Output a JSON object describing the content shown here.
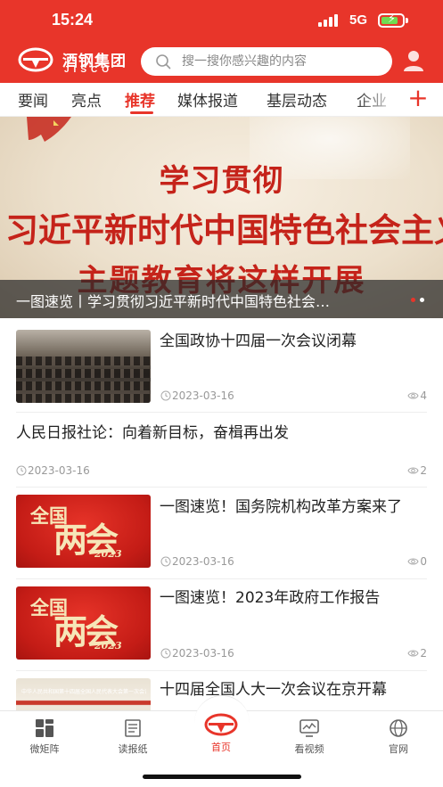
{
  "status_bar": {
    "time": "15:24",
    "network": "5G"
  },
  "header": {
    "logo_name": "酒钢集团",
    "logo_en": "JISCO",
    "search_placeholder": "搜一搜你感兴趣的内容",
    "brand_color": "#e8352a"
  },
  "tabs": [
    {
      "label": "要闻",
      "active": false
    },
    {
      "label": "亮点",
      "active": false
    },
    {
      "label": "推荐",
      "active": true
    },
    {
      "label": "媒体报道",
      "active": false
    },
    {
      "label": "基层动态",
      "active": false
    },
    {
      "label": "企业",
      "active": false
    }
  ],
  "add_tab_label": "+",
  "banner": {
    "line1": "学习贯彻",
    "line2": "习近平新时代中国特色社会主义思想",
    "line3": "主题教育将这样开展",
    "caption": "一图速览丨学习贯彻习近平新时代中国特色社会…",
    "page_count": 2,
    "active_page": 1
  },
  "news": [
    {
      "title": "全国政协十四届一次会议闭幕",
      "date": "2023-03-16",
      "views": "4",
      "thumb": "photo"
    },
    {
      "title": "人民日报社论：向着新目标，奋楫再出发",
      "date": "2023-03-16",
      "views": "2",
      "thumb": "none"
    },
    {
      "title": "一图速览！国务院机构改革方案来了",
      "date": "2023-03-16",
      "views": "0",
      "thumb": "lianghui"
    },
    {
      "title": "一图速览！2023年政府工作报告",
      "date": "2023-03-16",
      "views": "2",
      "thumb": "lianghui"
    },
    {
      "title": "十四届全国人大一次会议在京开幕",
      "thumb": "stage"
    }
  ],
  "thumb_text": {
    "quanguo": "全国",
    "lianghui": "两会",
    "year": "2023",
    "stage_banner": "中华人民共和国第十四届全国人民代表大会第一次会议"
  },
  "bottom_nav": [
    {
      "label": "微矩阵",
      "icon": "grid-icon",
      "active": false
    },
    {
      "label": "读报纸",
      "icon": "newspaper-icon",
      "active": false
    },
    {
      "label": "首页",
      "icon": "home-logo-icon",
      "active": true
    },
    {
      "label": "看视频",
      "icon": "video-icon",
      "active": false
    },
    {
      "label": "官网",
      "icon": "globe-icon",
      "active": false
    }
  ]
}
